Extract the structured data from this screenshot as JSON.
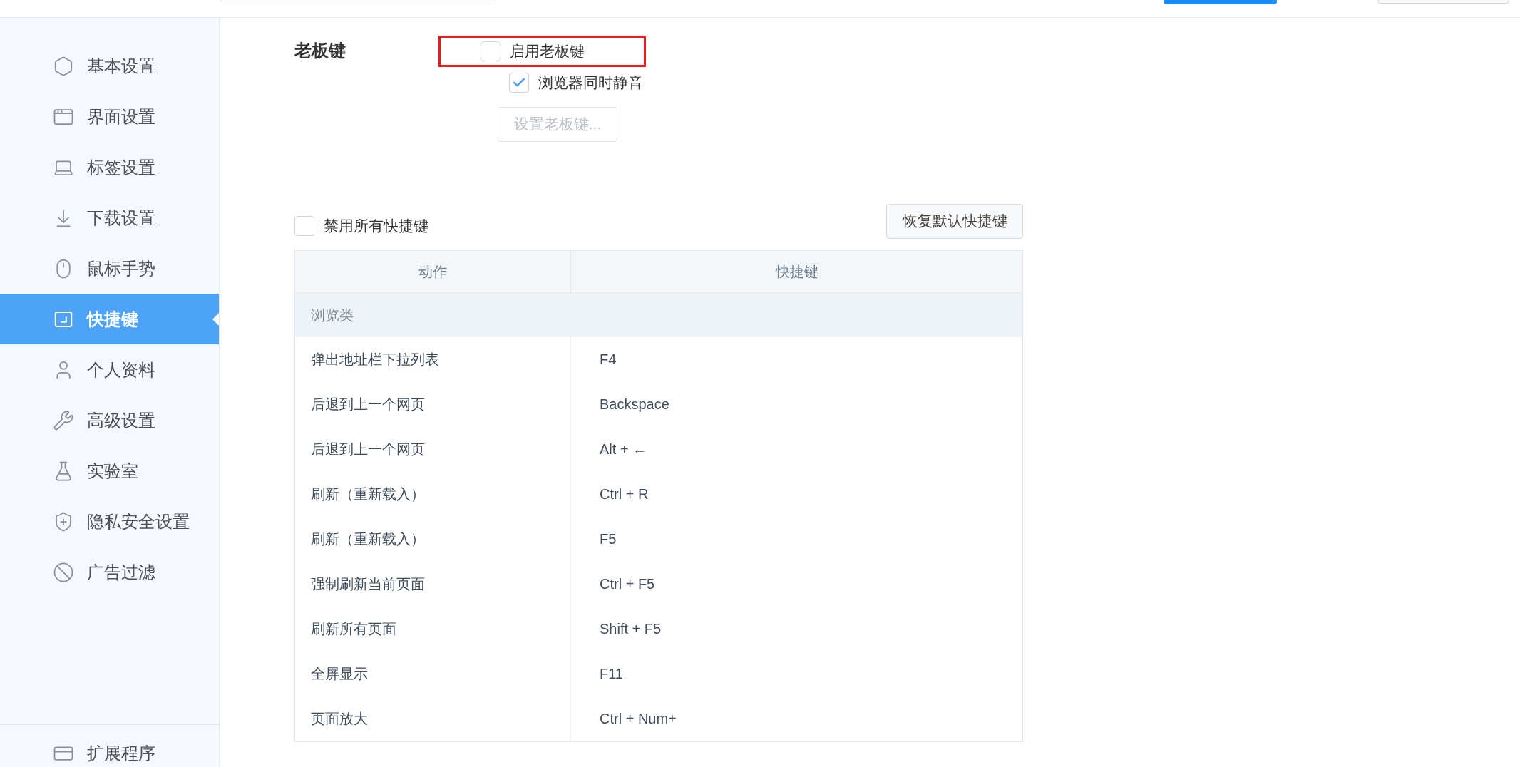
{
  "sidebar": {
    "items": [
      {
        "label": "基本设置",
        "selected": false
      },
      {
        "label": "界面设置",
        "selected": false
      },
      {
        "label": "标签设置",
        "selected": false
      },
      {
        "label": "下载设置",
        "selected": false
      },
      {
        "label": "鼠标手势",
        "selected": false
      },
      {
        "label": "快捷键",
        "selected": true
      },
      {
        "label": "个人资料",
        "selected": false
      },
      {
        "label": "高级设置",
        "selected": false
      },
      {
        "label": "实验室",
        "selected": false
      },
      {
        "label": "隐私安全设置",
        "selected": false
      },
      {
        "label": "广告过滤",
        "selected": false
      }
    ],
    "footer_item": {
      "label": "扩展程序"
    }
  },
  "boss_key": {
    "label": "老板键",
    "enable": {
      "label": "启用老板键",
      "checked": false,
      "highlighted": true
    },
    "mute": {
      "label": "浏览器同时静音",
      "checked": true
    },
    "button": {
      "label": "设置老板键...",
      "disabled": true
    }
  },
  "shortcuts": {
    "disable_all": {
      "label": "禁用所有快捷键",
      "checked": false
    },
    "reset_button": "恢复默认快捷键",
    "table": {
      "columns": [
        "动作",
        "快捷键"
      ],
      "groups": [
        {
          "name": "浏览类",
          "rows": [
            {
              "action": "弹出地址栏下拉列表",
              "keys": "F4"
            },
            {
              "action": "后退到上一个网页",
              "keys": "Backspace"
            },
            {
              "action": "后退到上一个网页",
              "keys": "Alt + ←"
            },
            {
              "action": "刷新（重新载入）",
              "keys": "Ctrl + R"
            },
            {
              "action": "刷新（重新载入）",
              "keys": "F5"
            },
            {
              "action": "强制刷新当前页面",
              "keys": "Ctrl + F5"
            },
            {
              "action": "刷新所有页面",
              "keys": "Shift + F5"
            },
            {
              "action": "全屏显示",
              "keys": "F11"
            },
            {
              "action": "页面放大",
              "keys": "Ctrl + Num+"
            }
          ]
        }
      ]
    }
  }
}
